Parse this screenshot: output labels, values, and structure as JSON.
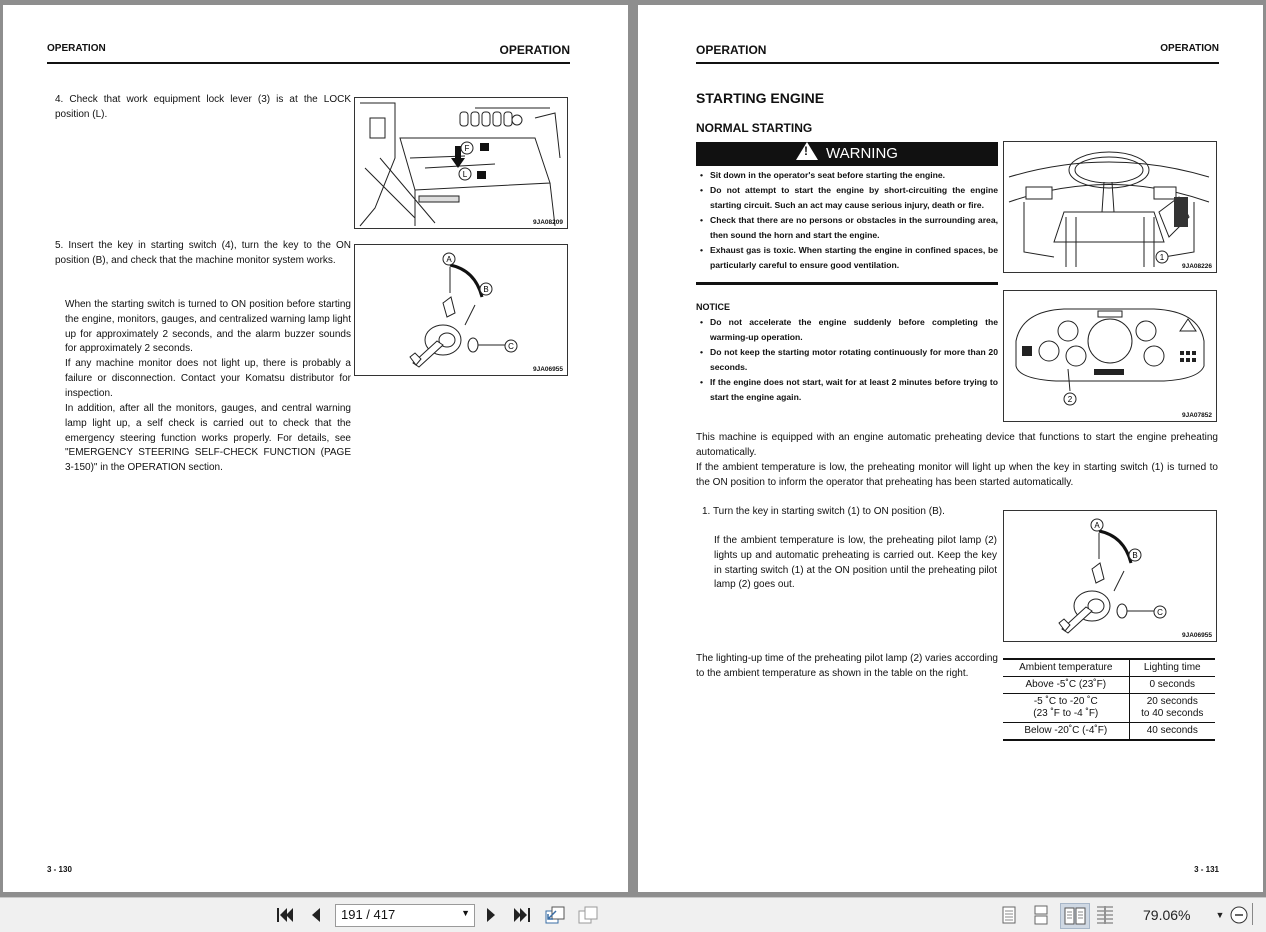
{
  "left_page": {
    "header_left": "OPERATION",
    "header_right": "OPERATION",
    "step4": "4. Check that work equipment lock lever (3) is at the LOCK position (L).",
    "fig1_caption": "9JA08209",
    "step5_a": "5. Insert the key in starting switch (4), turn the key to the ON position (B), and check that the machine monitor system works.",
    "step5_b": "When the starting switch is turned to ON position before starting the engine, monitors, gauges, and centralized warning lamp light up for approximately 2 seconds, and the alarm buzzer sounds for approximately 2 seconds.",
    "step5_c": "If any machine monitor does not light up, there is probably a failure or disconnection. Contact your Komatsu distributor for inspection.",
    "step5_d": "In addition, after all the monitors, gauges, and central warning lamp light up, a self check is carried out to check that the emergency steering function works properly.  For details, see \"EMERGENCY STEERING SELF-CHECK FUNCTION (PAGE 3-150)\"  in the OPERATION section.",
    "fig2_caption": "9JA06955",
    "page_number": "3 - 130"
  },
  "right_page": {
    "header_left": "OPERATION",
    "header_right": "OPERATION",
    "title": "STARTING ENGINE",
    "subtitle": "NORMAL STARTING",
    "warning_label": "WARNING",
    "warnings": [
      "Sit down in the operator's seat before starting the engine.",
      "Do not attempt to start the engine by short-circuiting the engine starting circuit. Such an act may cause serious injury, death or fire.",
      "Check that there are no persons or obstacles in the surrounding area, then sound the horn and start the engine.",
      "Exhaust gas is toxic. When starting the engine in confined spaces, be particularly careful to ensure good ventilation."
    ],
    "notice_label": "NOTICE",
    "notices": [
      "Do not accelerate the engine suddenly before completing the warming-up operation.",
      "Do not keep the starting motor rotating continuously for more than 20 seconds.",
      "If the engine does not start, wait for at least 2 minutes before trying to start the engine again."
    ],
    "fig3_caption": "9JA08226",
    "fig4_caption": "9JA07852",
    "intro_1": "This machine is equipped with an engine automatic preheating device that functions to start the engine preheating automatically.",
    "intro_2": "If the ambient temperature is low, the preheating monitor will light up when the key in starting switch (1) is turned to the ON position to inform the operator that preheating has been started automatically.",
    "step1": "1. Turn the key in starting switch (1) to ON position (B).",
    "step1_detail": "If the ambient temperature is low, the preheating pilot lamp (2) lights up and automatic preheating is carried out.  Keep the key in starting switch (1) at the ON position until the preheating pilot lamp (2) goes out.",
    "fig5_caption": "9JA06955",
    "lighting_text": "The lighting-up time of the preheating pilot lamp (2) varies according to the ambient temperature as shown in the table on the right.",
    "table": {
      "headers": [
        "Ambient temperature",
        "Lighting time"
      ],
      "rows": [
        [
          "Above -5˚C (23˚F)",
          "0 seconds"
        ],
        [
          "-5 ˚C to -20 ˚C\n(23 ˚F to -4 ˚F)",
          "20 seconds\nto 40 seconds"
        ],
        [
          "Below -20˚C (-4˚F)",
          "40 seconds"
        ]
      ]
    },
    "page_number": "3 - 131"
  },
  "labels": {
    "A": "A",
    "B": "B",
    "C": "C",
    "F": "F",
    "L": "L",
    "one": "1",
    "two": "2"
  },
  "toolbar": {
    "page_field": "191 / 417",
    "zoom": "79.06%"
  }
}
